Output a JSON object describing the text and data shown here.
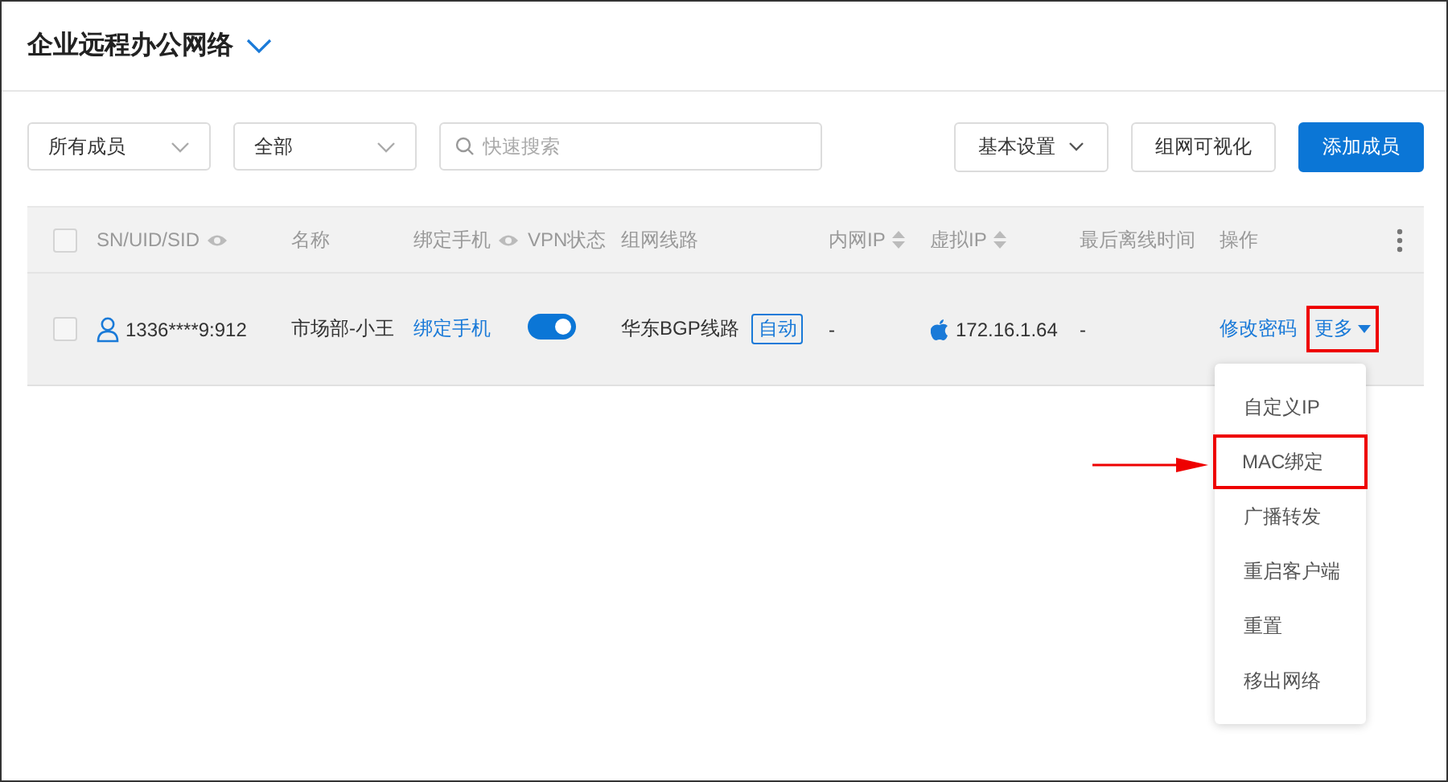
{
  "header": {
    "title": "企业远程办公网络"
  },
  "filters": [
    {
      "value": "所有成员"
    },
    {
      "value": "全部"
    }
  ],
  "search": {
    "placeholder": "快速搜索"
  },
  "toolbar_buttons": [
    {
      "label": "基本设置",
      "kind": "dropdown"
    },
    {
      "label": "组网可视化",
      "kind": "plain"
    },
    {
      "label": "添加成员",
      "kind": "primary"
    }
  ],
  "table": {
    "header_checked": false,
    "columns": [
      {
        "label": "SN/UID/SID",
        "kind": "eye"
      },
      {
        "label": "名称",
        "kind": "plain"
      },
      {
        "label": "绑定手机",
        "kind": "eye"
      },
      {
        "label": "VPN状态",
        "kind": "plain"
      },
      {
        "label": "组网线路",
        "kind": "plain"
      },
      {
        "label": "内网IP",
        "kind": "sort"
      },
      {
        "label": "虚拟IP",
        "kind": "sort"
      },
      {
        "label": "最后离线时间",
        "kind": "plain"
      },
      {
        "label": "操作",
        "kind": "plain"
      }
    ],
    "rows": [
      {
        "checked": false,
        "id": "1336****9:912",
        "name": "市场部-小王",
        "phone_link": "绑定手机",
        "vpn_on": true,
        "route": "华东BGP线路",
        "route_tag": "自动",
        "lan_ip": "-",
        "virtual_ip": "172.16.1.64",
        "last_offline": "-",
        "action_link": "修改密码",
        "more": "更多",
        "more_highlighted": true
      }
    ]
  },
  "more_menu": {
    "items": [
      {
        "label": "自定义IP",
        "highlighted": false
      },
      {
        "label": "MAC绑定",
        "highlighted": true
      },
      {
        "label": "广播转发",
        "highlighted": false
      },
      {
        "label": "重启客户端",
        "highlighted": false
      },
      {
        "label": "重置",
        "highlighted": false
      },
      {
        "label": "移出网络",
        "highlighted": false
      }
    ]
  }
}
